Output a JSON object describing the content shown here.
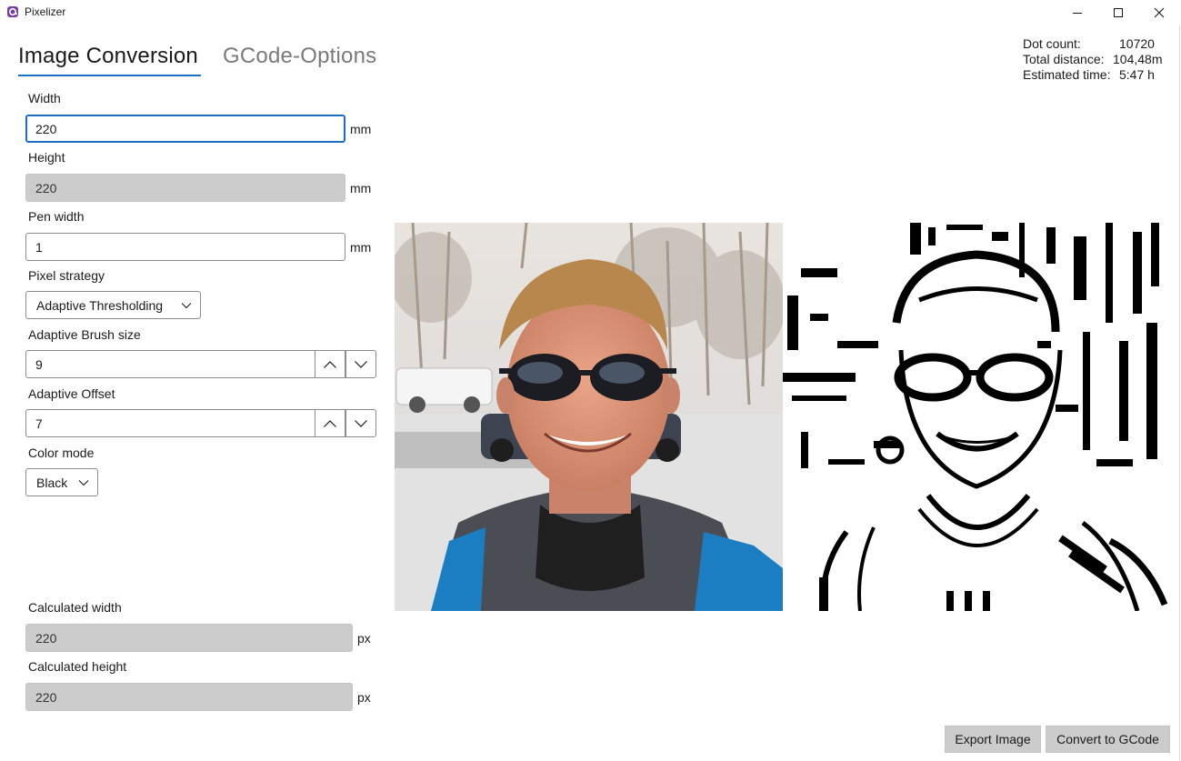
{
  "window": {
    "title": "Pixelizer",
    "icon": "app-logo-icon",
    "controls": [
      "minimize-icon",
      "maximize-icon",
      "close-icon"
    ]
  },
  "tabs": [
    {
      "label": "Image Conversion",
      "active": true
    },
    {
      "label": "GCode-Options",
      "active": false
    }
  ],
  "stats": {
    "dot_count_label": "Dot count:",
    "dot_count_value": "10720",
    "total_distance_label": "Total distance:",
    "total_distance_value": "104,48m",
    "estimated_time_label": "Estimated time:",
    "estimated_time_value": "5:47 h"
  },
  "form": {
    "width": {
      "label": "Width",
      "value": "220",
      "unit": "mm"
    },
    "height": {
      "label": "Height",
      "value": "220",
      "unit": "mm"
    },
    "pen_width": {
      "label": "Pen width",
      "value": "1",
      "unit": "mm"
    },
    "pixel_strategy": {
      "label": "Pixel strategy",
      "value": "Adaptive Thresholding"
    },
    "adaptive_brush_size": {
      "label": "Adaptive Brush size",
      "value": "9"
    },
    "adaptive_offset": {
      "label": "Adaptive Offset",
      "value": "7"
    },
    "color_mode": {
      "label": "Color mode",
      "value": "Black"
    },
    "calculated_width": {
      "label": "Calculated width",
      "value": "220",
      "unit": "px"
    },
    "calculated_height": {
      "label": "Calculated height",
      "value": "220",
      "unit": "px"
    }
  },
  "images": {
    "source": "source-photo",
    "result": "thresholded-preview"
  },
  "buttons": {
    "export": "Export Image",
    "convert": "Convert to GCode"
  },
  "colors": {
    "accent": "#1a73c8",
    "disabled_field": "#cccccc",
    "button_bg": "#cccccc"
  }
}
